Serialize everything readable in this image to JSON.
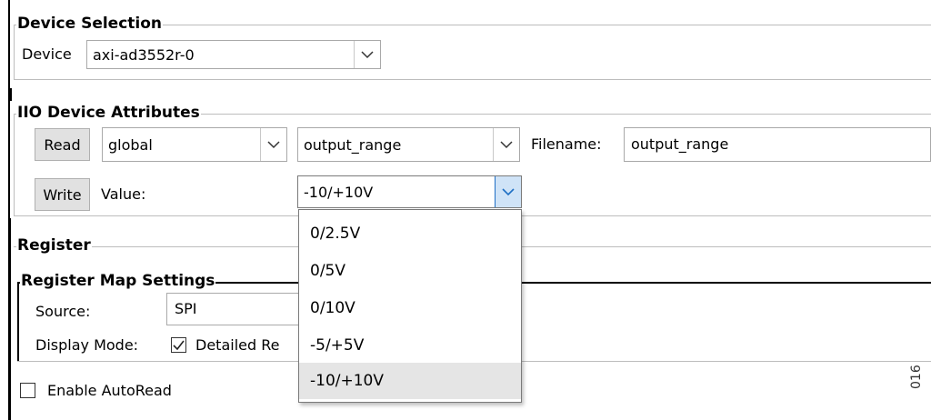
{
  "device_selection": {
    "title": "Device Selection",
    "device_label": "Device",
    "device_value": "axi-ad3552r-0"
  },
  "iio_attributes": {
    "title": "IIO Device Attributes",
    "read_button": "Read",
    "channel_value": "global",
    "attribute_value": "output_range",
    "filename_label": "Filename:",
    "filename_value": "output_range",
    "write_button": "Write",
    "value_label": "Value:",
    "value_selected": "-10/+10V",
    "value_options": [
      "0/2.5V",
      "0/5V",
      "0/10V",
      "-5/+5V",
      "-10/+10V"
    ],
    "highlighted_option_index": 4
  },
  "register": {
    "title": "Register",
    "map_settings_title": "Register Map Settings",
    "source_label": "Source:",
    "source_value": "SPI",
    "display_mode_label": "Display Mode:",
    "detailed_checkbox_label": "Detailed Re",
    "detailed_checked": true
  },
  "enable_autoread": {
    "label": "Enable AutoRead",
    "checked": false
  },
  "figure_id": "016",
  "colors": {
    "button_bg": "#e1e1e1",
    "selected_option_bg": "#e5e5e5",
    "dropdown_arrow_active": "#1e6fc4"
  }
}
